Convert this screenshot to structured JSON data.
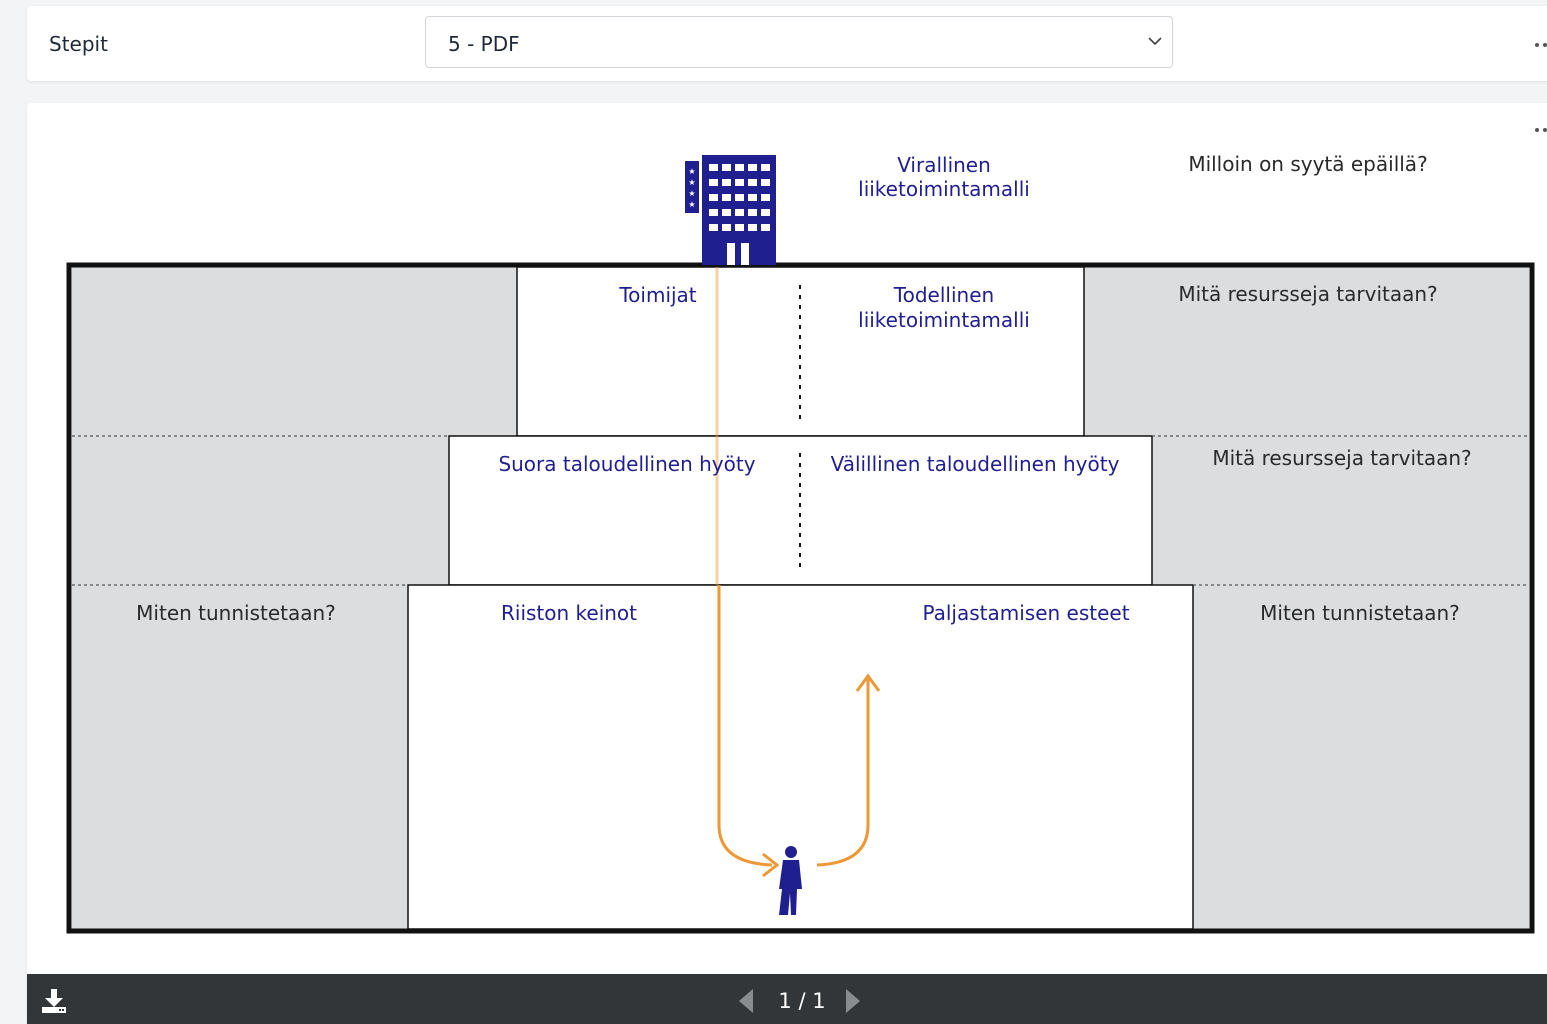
{
  "steps": {
    "label": "Stepit",
    "selected": "5 - PDF"
  },
  "diagram": {
    "official_model": [
      "Virallinen",
      "liiketoimintamalli"
    ],
    "question_top": "Milloin on syytä epäillä?",
    "actors": "Toimijat",
    "real_model": [
      "Todellinen",
      "liiketoimintamalli"
    ],
    "resources_q1": "Mitä resursseja tarvitaan?",
    "direct_benefit": "Suora taloudellinen hyöty",
    "indirect_benefit": "Välillinen taloudellinen hyöty",
    "resources_q2": "Mitä resursseja tarvitaan?",
    "identify_left": "Miten tunnistetaan?",
    "exploitation_means": "Riiston keinot",
    "disclosure_barriers": "Paljastamisen esteet",
    "identify_right": "Miten tunnistetaan?"
  },
  "viewer": {
    "page_counter": "1 / 1"
  },
  "colors": {
    "diagram_blue": "#1f1f8f",
    "text_dark": "#2a2a2a",
    "panel_grey": "#dcdddf",
    "arrow_orange": "#ee9735",
    "toolbar_bg": "#323639"
  },
  "icons": {
    "dropdown": "chevron-down-icon",
    "menu": "more-dots-icon",
    "download": "download-icon",
    "prev": "prev-page-icon",
    "next": "next-page-icon",
    "building": "building-icon",
    "person": "worker-figure-icon"
  }
}
